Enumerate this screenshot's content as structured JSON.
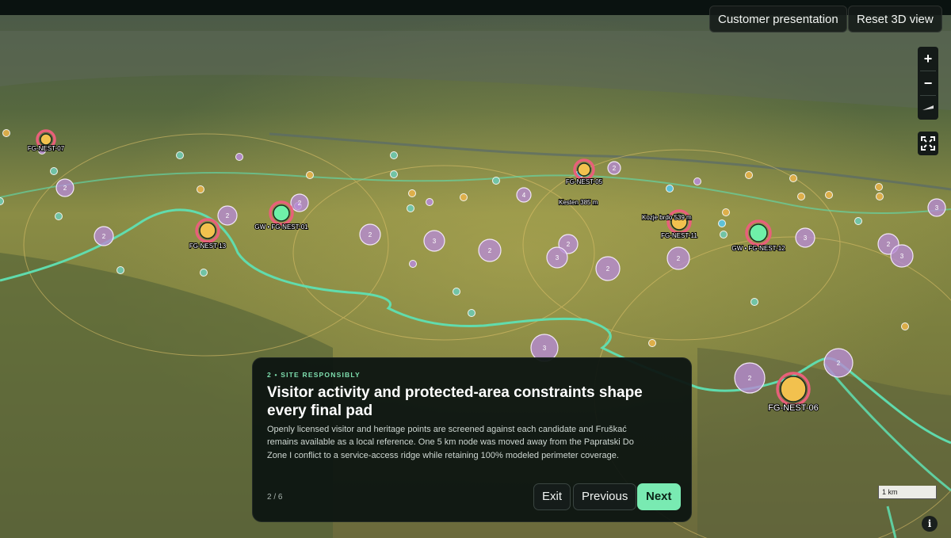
{
  "toolbar": {
    "customer_presentation_label": "Customer presentation",
    "reset_3d_label": "Reset 3D view"
  },
  "map_controls": {
    "zoom_in": "+",
    "zoom_out": "−",
    "fullscreen_icon": "fullscreen-icon",
    "compass_icon": "compass-icon"
  },
  "sites": [
    {
      "label": "FG-NEST-07",
      "kind": "nest"
    },
    {
      "label": "FG-NEST-13",
      "kind": "nest"
    },
    {
      "label": "GW • FG-NEST-01",
      "kind": "gateway"
    },
    {
      "label": "FG-NEST-05",
      "kind": "nest"
    },
    {
      "label": "FG-NEST-11",
      "kind": "nest"
    },
    {
      "label": "GW • FG-NEST-12",
      "kind": "gateway"
    },
    {
      "label": "FG-NEST-06",
      "kind": "nest"
    }
  ],
  "place_labels": [
    "Kesten 385 m",
    "Kozje brdo 539 m"
  ],
  "cluster_counts": [
    "2",
    "2",
    "2",
    "2",
    "2",
    "3",
    "2",
    "2",
    "3",
    "2",
    "2",
    "3",
    "2",
    "3",
    "4",
    "2",
    "3",
    "3",
    "2",
    "2"
  ],
  "tour": {
    "step_label": "2 • SITE RESPONSIBLY",
    "title": "Visitor activity and protected-area constraints shape every final pad",
    "body": "Openly licensed visitor and heritage points are screened against each candidate and Fruškać remains available as a local reference. One 5 km node was moved away from the Papratski Do Zone I conflict to a service-access ridge while retaining 100% modeled perimeter coverage.",
    "progress": "2 / 6",
    "exit_label": "Exit",
    "previous_label": "Previous",
    "next_label": "Next"
  },
  "scale_label": "1 km",
  "info_label": "i",
  "colors": {
    "accent": "#79eab2",
    "nest_ring": "#e8607a",
    "nest_fill": "#f2c14e",
    "gateway_fill": "#6ff0a8",
    "cluster_fill": "#b78bd3",
    "boundary": "#5fe0b3"
  }
}
